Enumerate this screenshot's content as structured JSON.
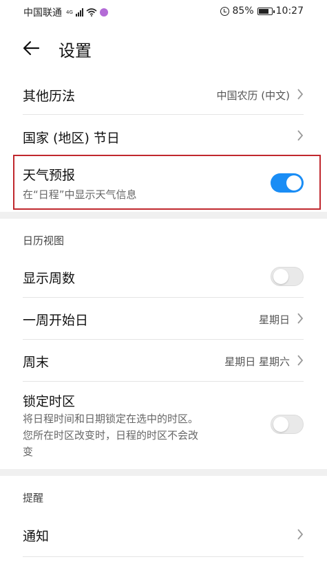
{
  "status_bar": {
    "carrier": "中国联通",
    "network_type": "4G",
    "battery_percent": "85%",
    "time": "10:27",
    "battery_level": 0.85
  },
  "header": {
    "title": "设置"
  },
  "items": {
    "other_calendar": {
      "label": "其他历法",
      "value": "中国农历 (中文)"
    },
    "holidays": {
      "label": "国家 (地区) 节日"
    },
    "weather": {
      "label": "天气预报",
      "description": "在“日程”中显示天气信息",
      "enabled": true
    }
  },
  "calendar_view": {
    "section_title": "日历视图",
    "show_week_number": {
      "label": "显示周数",
      "enabled": false
    },
    "week_start": {
      "label": "一周开始日",
      "value": "星期日"
    },
    "weekend": {
      "label": "周末",
      "value": "星期日 星期六"
    },
    "lock_timezone": {
      "label": "锁定时区",
      "description_line1": "将日程时间和日期锁定在选中的时区。",
      "description_line2": "您所在时区改变时，日程的时区不会改",
      "description_line3": "变",
      "enabled": false
    }
  },
  "reminders": {
    "section_title": "提醒",
    "notification": {
      "label": "通知"
    }
  },
  "colors": {
    "accent": "#1a8df5",
    "highlight_border": "#c0272d"
  }
}
